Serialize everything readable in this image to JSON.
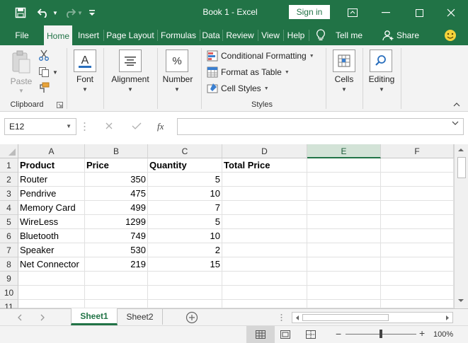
{
  "titlebar": {
    "title": "Book 1 -  Excel",
    "sign_in": "Sign in"
  },
  "tabs": [
    "File",
    "Home",
    "Insert",
    "Page Layout",
    "Formulas",
    "Data",
    "Review",
    "View",
    "Help"
  ],
  "tell_me": "Tell me",
  "share": "Share",
  "ribbon": {
    "clipboard": {
      "paste": "Paste",
      "group_label": "Clipboard"
    },
    "font": "Font",
    "alignment": "Alignment",
    "number": "Number",
    "styles": {
      "conditional_formatting": "Conditional Formatting",
      "format_as_table": "Format as Table",
      "cell_styles": "Cell Styles",
      "group_label": "Styles"
    },
    "cells": "Cells",
    "editing": "Editing"
  },
  "formula_bar": {
    "name_box": "E12",
    "fx": "fx",
    "formula": ""
  },
  "columns": [
    "A",
    "B",
    "C",
    "D",
    "E",
    "F"
  ],
  "rows": [
    {
      "num": "1",
      "cells": [
        "Product",
        "Price",
        "Quantity",
        "Total Price",
        "",
        ""
      ]
    },
    {
      "num": "2",
      "cells": [
        "Router",
        "350",
        "5",
        "",
        "",
        ""
      ]
    },
    {
      "num": "3",
      "cells": [
        "Pendrive",
        "475",
        "10",
        "",
        "",
        ""
      ]
    },
    {
      "num": "4",
      "cells": [
        "Memory Card",
        "499",
        "7",
        "",
        "",
        ""
      ]
    },
    {
      "num": "5",
      "cells": [
        "WireLess",
        "1299",
        "5",
        "",
        "",
        ""
      ]
    },
    {
      "num": "6",
      "cells": [
        "Bluetooth",
        "749",
        "10",
        "",
        "",
        ""
      ]
    },
    {
      "num": "7",
      "cells": [
        "Speaker",
        "530",
        "2",
        "",
        "",
        ""
      ]
    },
    {
      "num": "8",
      "cells": [
        "Net Connector",
        "219",
        "15",
        "",
        "",
        ""
      ]
    },
    {
      "num": "9",
      "cells": [
        "",
        "",
        "",
        "",
        "",
        ""
      ]
    },
    {
      "num": "10",
      "cells": [
        "",
        "",
        "",
        "",
        "",
        ""
      ]
    },
    {
      "num": "11",
      "cells": [
        "",
        "",
        "",
        "",
        "",
        ""
      ]
    }
  ],
  "sheets": [
    "Sheet1",
    "Sheet2"
  ],
  "active_sheet": "Sheet1",
  "status": {
    "zoom": "100%"
  },
  "colors": {
    "accent": "#217346",
    "selected_col": "#d3e3d7"
  }
}
